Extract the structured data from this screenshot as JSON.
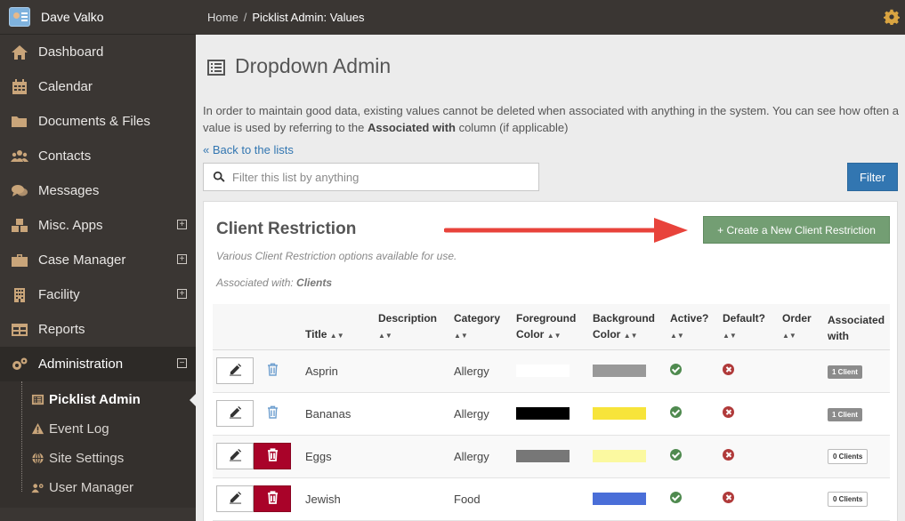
{
  "user": {
    "name": "Dave Valko"
  },
  "sidebar": {
    "items": [
      {
        "label": "Dashboard",
        "icon": "home-icon"
      },
      {
        "label": "Calendar",
        "icon": "calendar-icon"
      },
      {
        "label": "Documents & Files",
        "icon": "folder-icon"
      },
      {
        "label": "Contacts",
        "icon": "users-icon"
      },
      {
        "label": "Messages",
        "icon": "comments-icon"
      },
      {
        "label": "Misc. Apps",
        "icon": "cubes-icon",
        "expand": "+"
      },
      {
        "label": "Case Manager",
        "icon": "briefcase-icon",
        "expand": "+"
      },
      {
        "label": "Facility",
        "icon": "building-icon",
        "expand": "+"
      },
      {
        "label": "Reports",
        "icon": "table-icon"
      },
      {
        "label": "Administration",
        "icon": "gears-icon",
        "expand": "−"
      }
    ],
    "subitems": [
      {
        "label": "Picklist Admin",
        "icon": "list-icon"
      },
      {
        "label": "Event Log",
        "icon": "warning-icon"
      },
      {
        "label": "Site Settings",
        "icon": "globe-icon"
      },
      {
        "label": "User Manager",
        "icon": "users-gear-icon"
      }
    ]
  },
  "breadcrumb": {
    "home": "Home",
    "separator": "/",
    "current": "Picklist Admin: Values"
  },
  "page": {
    "title": "Dropdown Admin",
    "intro_1": "In order to maintain good data, existing values cannot be deleted when associated with anything in the system. You can see how often a value is used by referring to the ",
    "intro_bold": "Associated with",
    "intro_2": " column (if applicable)",
    "back_link": "« Back to the lists",
    "search_placeholder": "Filter this list by anything",
    "filter_label": "Filter"
  },
  "panel": {
    "title": "Client Restriction",
    "description": "Various Client Restriction options available for use.",
    "assoc_prefix": "Associated with: ",
    "assoc_value": "Clients",
    "create_label": "+ Create a New Client Restriction"
  },
  "table": {
    "headers": {
      "title": "Title",
      "description": "Description",
      "category": "Category",
      "foreground": "Foreground Color",
      "background": "Background Color",
      "active": "Active?",
      "default": "Default?",
      "order": "Order",
      "associated": "Associated with"
    },
    "rows": [
      {
        "title": "Asprin",
        "category": "Allergy",
        "fg": "#ffffff",
        "bg": "#999999",
        "assoc": "1 Client",
        "deletable": false
      },
      {
        "title": "Bananas",
        "category": "Allergy",
        "fg": "#000000",
        "bg": "#f7e43a",
        "assoc": "1 Client",
        "deletable": false
      },
      {
        "title": "Eggs",
        "category": "Allergy",
        "fg": "#777777",
        "bg": "#fbf9a0",
        "assoc": "0 Clients",
        "deletable": true
      },
      {
        "title": "Jewish",
        "category": "Food",
        "fg": "",
        "bg": "#4a6ed8",
        "assoc": "0 Clients",
        "deletable": true
      }
    ]
  },
  "colors": {
    "primary": "#3276b1",
    "success": "#739e73",
    "danger": "#a90329",
    "sidebar": "#3a3633",
    "arrow": "#e8433b"
  }
}
